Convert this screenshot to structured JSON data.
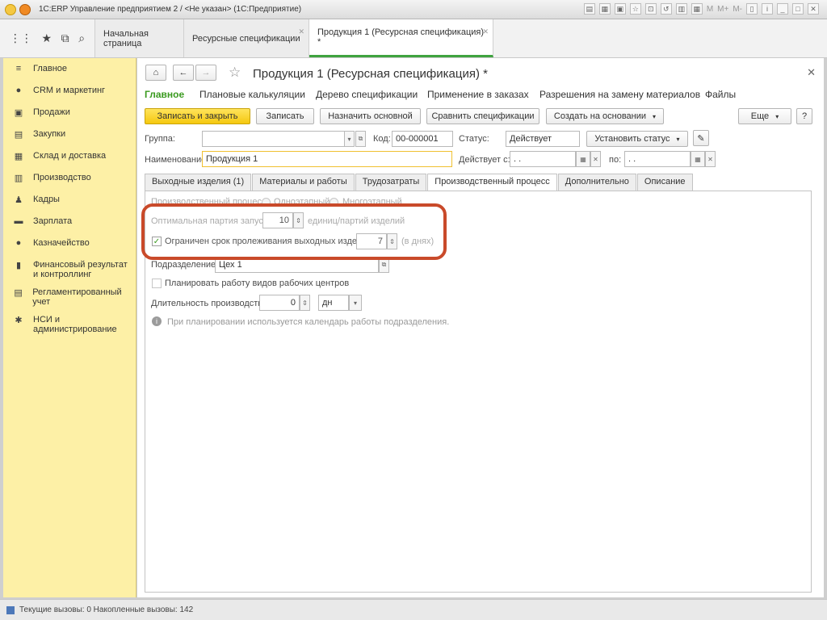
{
  "window": {
    "title": "1С:ERP Управление предприятием 2 / <Не указан>  (1С:Предприятие)",
    "tools": [
      "M",
      "M+",
      "M-"
    ]
  },
  "tabs_top": [
    {
      "label": "Начальная страница"
    },
    {
      "label": "Ресурсные спецификации"
    },
    {
      "label": "Продукция 1 (Ресурсная спецификация) *"
    }
  ],
  "sidebar": {
    "items": [
      {
        "label": "Главное",
        "icon": "≡"
      },
      {
        "label": "CRM и маркетинг",
        "icon": "●"
      },
      {
        "label": "Продажи",
        "icon": "▣"
      },
      {
        "label": "Закупки",
        "icon": "▤"
      },
      {
        "label": "Склад и доставка",
        "icon": "▦"
      },
      {
        "label": "Производство",
        "icon": "▥"
      },
      {
        "label": "Кадры",
        "icon": "♟"
      },
      {
        "label": "Зарплата",
        "icon": "▬"
      },
      {
        "label": "Казначейство",
        "icon": "●"
      },
      {
        "label": "Финансовый результат и контроллинг",
        "icon": "▮"
      },
      {
        "label": "Регламентированный учет",
        "icon": "▤"
      },
      {
        "label": "НСИ и администрирование",
        "icon": "✱"
      }
    ]
  },
  "form": {
    "title": "Продукция 1 (Ресурсная спецификация) *",
    "nav": [
      "Главное",
      "Плановые калькуляции",
      "Дерево спецификации",
      "Применение в заказах",
      "Разрешения на замену материалов",
      "Файлы"
    ],
    "buttons": {
      "save_close": "Записать и закрыть",
      "save": "Записать",
      "set_main": "Назначить основной",
      "compare": "Сравнить спецификации",
      "create_based": "Создать на основании",
      "more": "Еще",
      "help": "?"
    },
    "group_label": "Группа:",
    "group_value": "",
    "code_label": "Код:",
    "code_value": "00-000001",
    "status_label": "Статус:",
    "status_value": "Действует",
    "set_status": "Установить статус",
    "name_label": "Наименование:",
    "name_value": "Продукция 1",
    "valid_from_label": "Действует с:",
    "valid_from_value": " .  .",
    "valid_to_label": "по:",
    "valid_to_value": " .  .",
    "tabs": [
      "Выходные изделия (1)",
      "Материалы и работы",
      "Трудозатраты",
      "Производственный процесс",
      "Дополнительно",
      "Описание"
    ],
    "active_tab": 3,
    "process_label": "Производственный процесс:",
    "process_options": [
      "Одноэтапный",
      "Многоэтапный"
    ],
    "batch_label": "Оптимальная партия запуска:",
    "batch_value": "10",
    "batch_unit": "единиц/партий изделий",
    "storage_label": "Ограничен срок пролеживания выходных изделий",
    "storage_value": "7",
    "storage_unit": "(в днях)",
    "division_label": "Подразделение:",
    "division_value": "Цех 1",
    "plan_label": "Планировать работу видов рабочих центров",
    "duration_label": "Длительность производства:",
    "duration_value": "0",
    "duration_unit": "дн",
    "info_text": "При планировании используется календарь работы подразделения."
  },
  "status_bar": {
    "text": "Текущие вызовы: 0   Накопленные вызовы: 142"
  },
  "colors": {
    "sidebar_bg": "#fdf0a6",
    "accent_green": "#3a9a1f",
    "primary_button": "#f5c80f",
    "highlight": "#c94a2a"
  }
}
